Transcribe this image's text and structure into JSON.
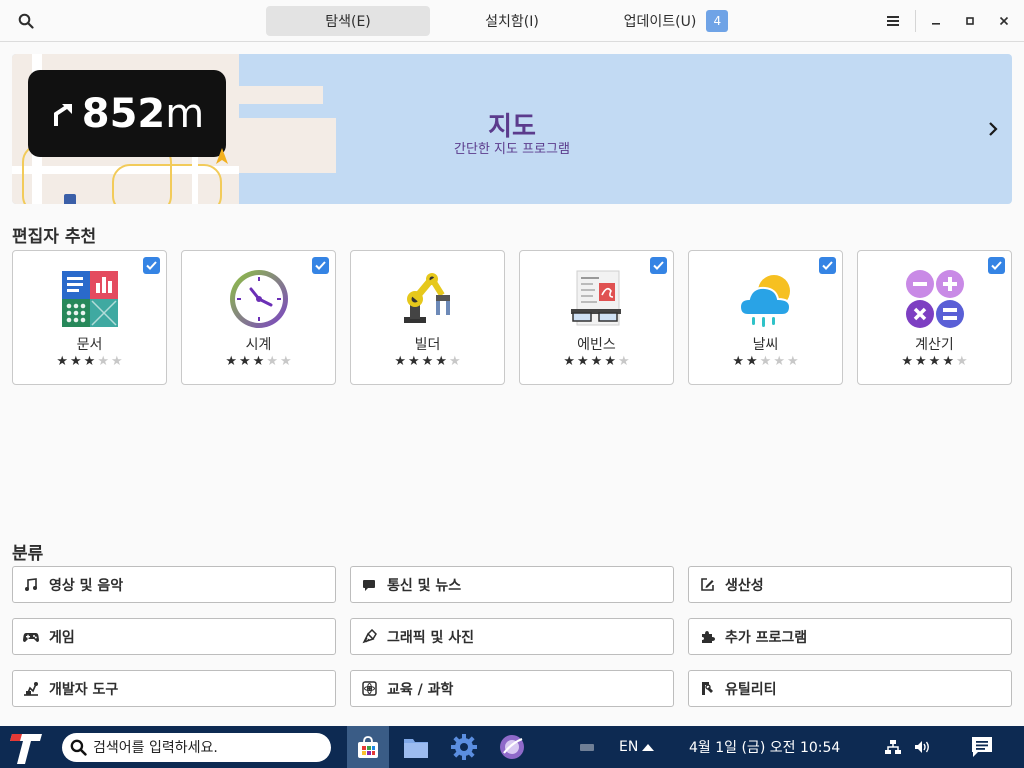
{
  "header": {
    "tabs": [
      {
        "label": "탐색(E)",
        "active": true
      },
      {
        "label": "설치함(I)",
        "active": false
      },
      {
        "label": "업데이트(U)",
        "active": false,
        "badge": "4"
      }
    ]
  },
  "banner": {
    "nav_distance": "852",
    "nav_unit": "m",
    "title": "지도",
    "subtitle": "간단한 지도 프로그램"
  },
  "editors_pick": {
    "title": "편집자 추천",
    "apps": [
      {
        "name": "문서",
        "rating": 3,
        "checked": true
      },
      {
        "name": "시계",
        "rating": 3,
        "checked": true
      },
      {
        "name": "빌더",
        "rating": 4,
        "checked": false
      },
      {
        "name": "에빈스",
        "rating": 4,
        "checked": true
      },
      {
        "name": "날씨",
        "rating": 2,
        "checked": true
      },
      {
        "name": "계산기",
        "rating": 4,
        "checked": true
      }
    ]
  },
  "categories": {
    "title": "분류",
    "items": [
      {
        "label": "영상 및 음악",
        "icon": "music-note-icon"
      },
      {
        "label": "통신 및 뉴스",
        "icon": "chat-bubble-icon"
      },
      {
        "label": "생산성",
        "icon": "edit-icon"
      },
      {
        "label": "게임",
        "icon": "gamepad-icon"
      },
      {
        "label": "그래픽 및 사진",
        "icon": "paint-icon"
      },
      {
        "label": "추가 프로그램",
        "icon": "puzzle-icon"
      },
      {
        "label": "개발자 도구",
        "icon": "tools-icon"
      },
      {
        "label": "교육 / 과학",
        "icon": "science-icon"
      },
      {
        "label": "유틸리티",
        "icon": "utility-icon"
      }
    ]
  },
  "taskbar": {
    "search_placeholder": "검색어를 입력하세요.",
    "lang": "EN",
    "clock": "4월 1일 (금) 오전 10:54"
  },
  "colors": {
    "accent": "#3584e4",
    "banner_bg": "#c2daf3",
    "banner_text": "#5b3b8c",
    "taskbar_bg": "#0d2a52"
  }
}
